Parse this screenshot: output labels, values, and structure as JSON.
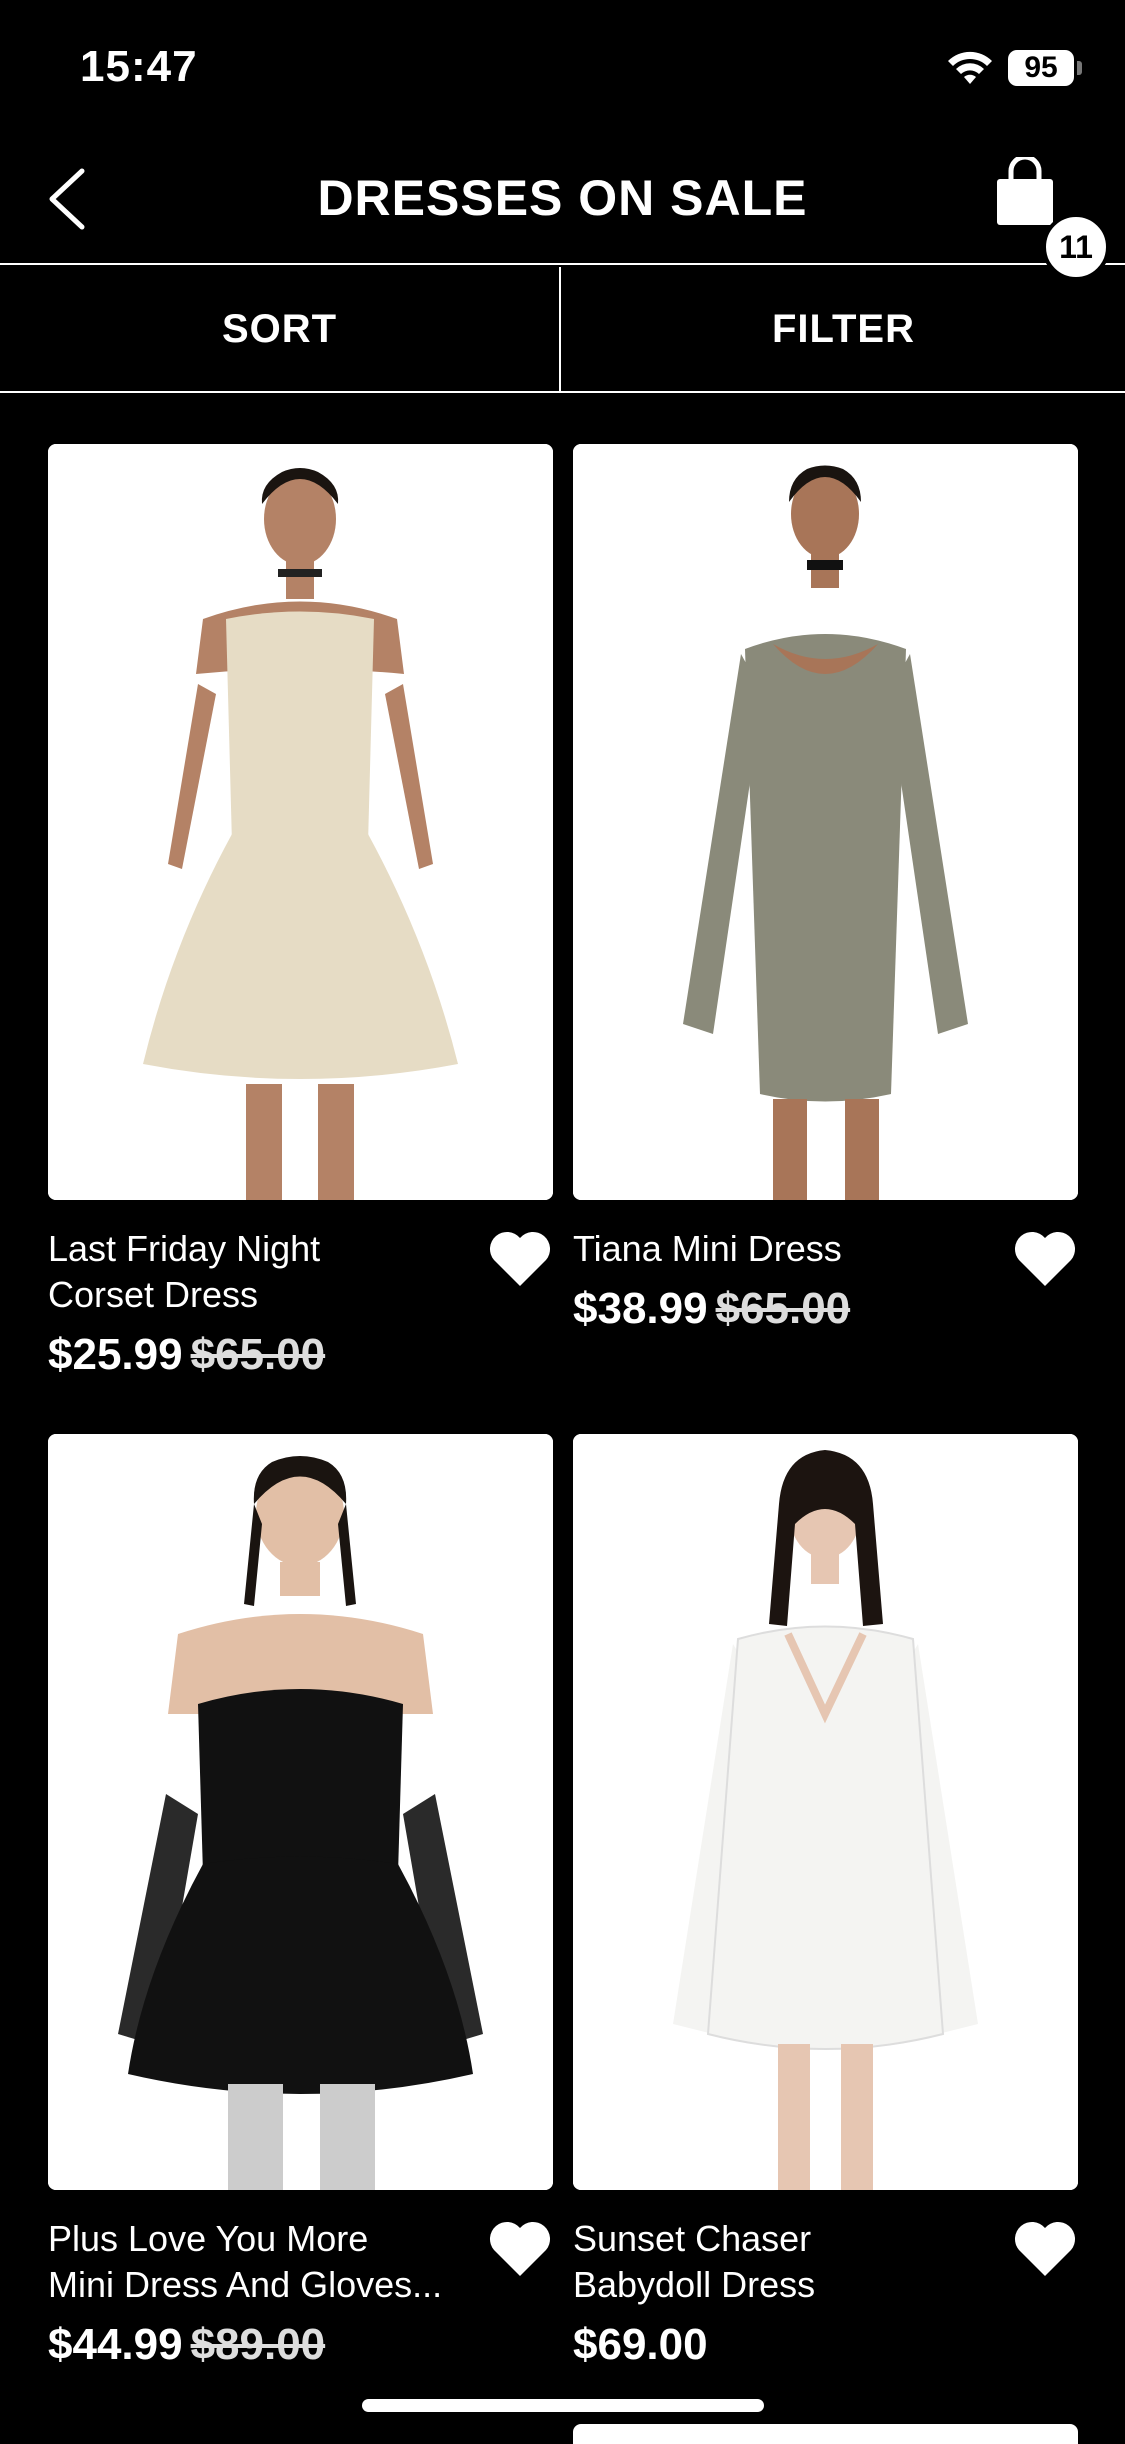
{
  "status_bar": {
    "time": "15:47",
    "battery": "95"
  },
  "nav": {
    "title": "DRESSES ON SALE",
    "cart_count": "11"
  },
  "controls": {
    "sort_label": "SORT",
    "filter_label": "FILTER"
  },
  "products": [
    {
      "name": "Last Friday Night\nCorset Dress",
      "price": "$25.99",
      "original_price": "$65.00",
      "dress_color": "#e6dcc5"
    },
    {
      "name": "Tiana Mini Dress",
      "price": "$38.99",
      "original_price": "$65.00",
      "dress_color": "#8a8a7a"
    },
    {
      "name": "Plus Love You More\nMini Dress And Gloves...",
      "price": "$44.99",
      "original_price": "$89.00",
      "dress_color": "#111111"
    },
    {
      "name": "Sunset Chaser\nBabydoll Dress",
      "price": "$69.00",
      "original_price": "",
      "dress_color": "#f4f4f2"
    }
  ]
}
